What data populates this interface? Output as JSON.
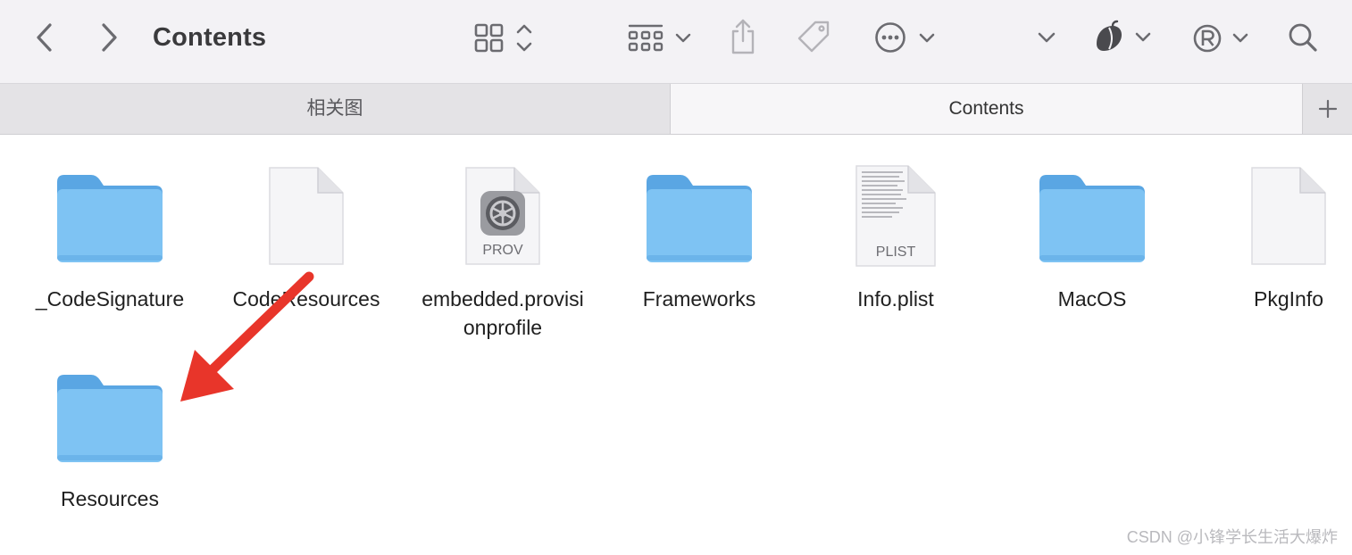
{
  "window": {
    "title": "Contents"
  },
  "toolbar": {
    "icons": [
      "back-icon",
      "forward-icon",
      "grid-view-icon",
      "group-icon",
      "share-icon",
      "tag-icon",
      "more-icon",
      "dropdown-icon",
      "acorn-icon",
      "registered-icon",
      "search-icon"
    ]
  },
  "tabs": [
    {
      "label": "相关图",
      "active": false
    },
    {
      "label": "Contents",
      "active": true
    }
  ],
  "files": [
    {
      "name": "_CodeSignature",
      "kind": "folder"
    },
    {
      "name": "CodeResources",
      "kind": "document"
    },
    {
      "name": "embedded.provisionprofile",
      "line1": "embedded.provisi",
      "line2": "onprofile",
      "kind": "provision",
      "badge": "PROV"
    },
    {
      "name": "Frameworks",
      "kind": "folder"
    },
    {
      "name": "Info.plist",
      "kind": "plist",
      "badge": "PLIST"
    },
    {
      "name": "MacOS",
      "kind": "folder"
    },
    {
      "name": "PkgInfo",
      "kind": "document"
    },
    {
      "name": "Resources",
      "kind": "folder"
    }
  ],
  "annotation": {
    "color": "#e8352a"
  },
  "colors": {
    "folder_front": "#7ec3f3",
    "folder_back": "#5aa6e3",
    "toolbar_bg": "#f3f2f5"
  },
  "watermark": "CSDN @小锋学长生活大爆炸"
}
